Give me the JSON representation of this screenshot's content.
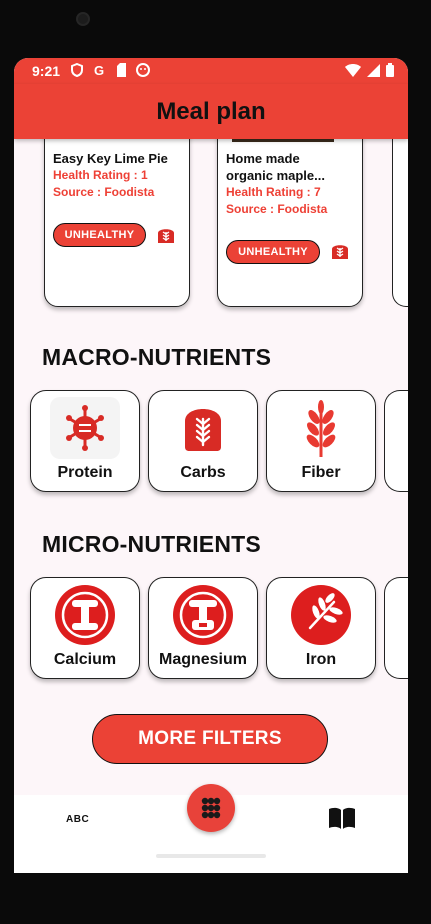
{
  "status_bar": {
    "time": "9:21",
    "left_icons": [
      "shield-icon",
      "google-icon",
      "sim-icon",
      "smiley-icon"
    ],
    "right_icons": [
      "wifi-icon",
      "signal-icon",
      "battery-icon"
    ]
  },
  "app_bar": {
    "title": "Meal plan"
  },
  "recipes": [
    {
      "title_line1": "Easy Key Lime Pie",
      "title_line2": "",
      "health_rating": "Health Rating : 1",
      "source": "Source : Foodista",
      "badge": "UNHEALTHY"
    },
    {
      "title_line1": "Home made",
      "title_line2": "organic maple...",
      "health_rating": "Health Rating : 7",
      "source": "Source : Foodista",
      "badge": "UNHEALTHY"
    }
  ],
  "macro": {
    "title": "MACRO-NUTRIENTS",
    "items": [
      {
        "label": "Protein",
        "icon": "protein-icon"
      },
      {
        "label": "Carbs",
        "icon": "bread-icon"
      },
      {
        "label": "Fiber",
        "icon": "wheat-icon"
      }
    ]
  },
  "micro": {
    "title": "MICRO-NUTRIENTS",
    "items": [
      {
        "label": "Calcium",
        "icon": "calcium-icon"
      },
      {
        "label": "Magnesium",
        "icon": "magnesium-icon"
      },
      {
        "label": "Iron",
        "icon": "iron-icon"
      }
    ]
  },
  "more_filters": {
    "label": "MORE FILTERS"
  },
  "bottom_nav": {
    "abc_label": "ABC",
    "center_icon": "grid-icon",
    "right_icon": "book-icon"
  },
  "colors": {
    "accent": "#eb4236",
    "background": "#fdf6f9"
  }
}
